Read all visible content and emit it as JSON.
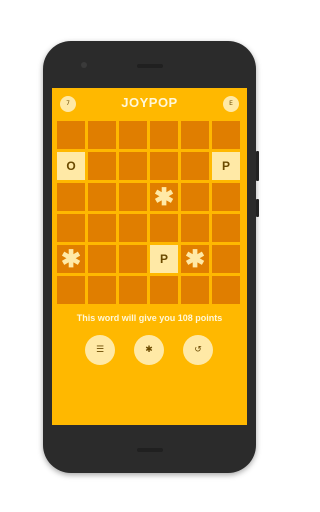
{
  "app": {
    "title": "JOYPOP"
  },
  "topbar": {
    "left_badge": "7",
    "right_badge": "E"
  },
  "grid": [
    [
      "",
      "",
      "",
      "",
      "",
      ""
    ],
    [
      "O",
      "",
      "",
      "",
      "",
      "P"
    ],
    [
      "",
      "",
      "",
      "✱",
      "",
      ""
    ],
    [
      "",
      "",
      "",
      "",
      "",
      ""
    ],
    [
      "✱",
      "",
      "",
      "P",
      "✱",
      ""
    ],
    [
      "",
      "",
      "",
      "",
      "",
      ""
    ]
  ],
  "message": "This word will give you 108 points",
  "actions": [
    {
      "icon": "list-icon",
      "glyph": "☰"
    },
    {
      "icon": "asterisk-icon",
      "glyph": "✱"
    },
    {
      "icon": "undo-icon",
      "glyph": "↺"
    }
  ],
  "colors": {
    "screen": "#ffb800",
    "tile": "#e07e00",
    "letter_tile": "#ffe9a6",
    "text": "#fff7d9"
  }
}
